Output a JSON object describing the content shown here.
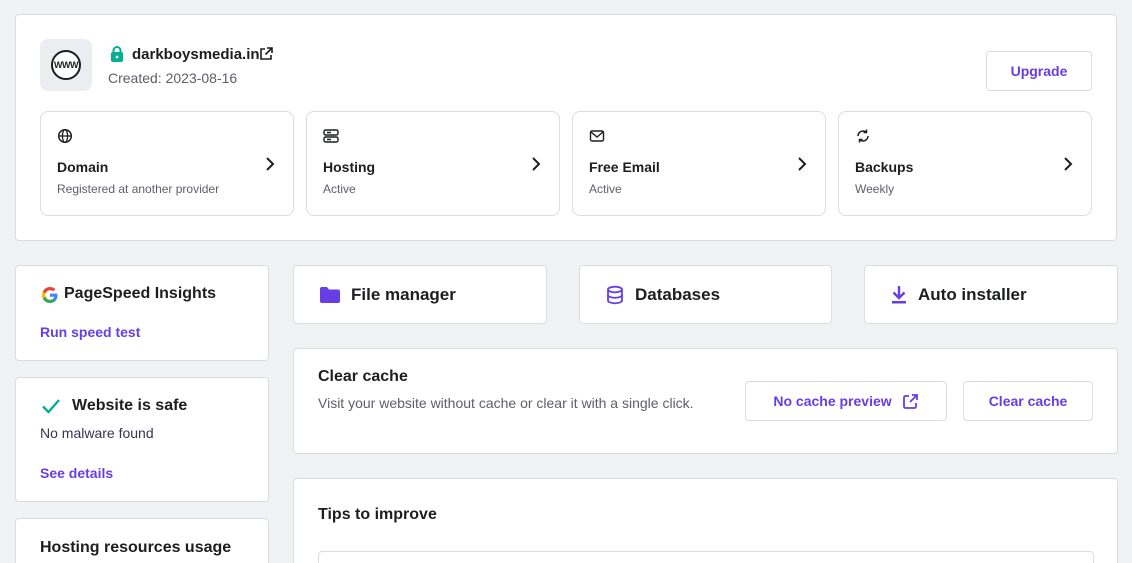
{
  "site": {
    "domain": "darkboysmedia.in",
    "created": "Created: 2023-08-16",
    "avatar_text": "WWW",
    "upgrade_label": "Upgrade"
  },
  "tiles": [
    {
      "title": "Domain",
      "subtitle": "Registered at another provider",
      "icon": "globe-icon"
    },
    {
      "title": "Hosting",
      "subtitle": "Active",
      "icon": "server-icon"
    },
    {
      "title": "Free Email",
      "subtitle": "Active",
      "icon": "mail-icon"
    },
    {
      "title": "Backups",
      "subtitle": "Weekly",
      "icon": "refresh-icon"
    }
  ],
  "pagespeed": {
    "title": "PageSpeed Insights",
    "link": "Run speed test"
  },
  "security": {
    "title": "Website is safe",
    "subtitle": "No malware found",
    "link": "See details"
  },
  "resources": {
    "title": "Hosting resources usage"
  },
  "quick_actions": [
    {
      "label": "File manager",
      "icon": "folder-icon"
    },
    {
      "label": "Databases",
      "icon": "database-icon"
    },
    {
      "label": "Auto installer",
      "icon": "download-icon"
    }
  ],
  "cache": {
    "title": "Clear cache",
    "description": "Visit your website without cache or clear it with a single click.",
    "preview_label": "No cache preview",
    "clear_label": "Clear cache"
  },
  "tips": {
    "title": "Tips to improve"
  },
  "colors": {
    "accent": "#673de6",
    "success": "#00b090"
  }
}
